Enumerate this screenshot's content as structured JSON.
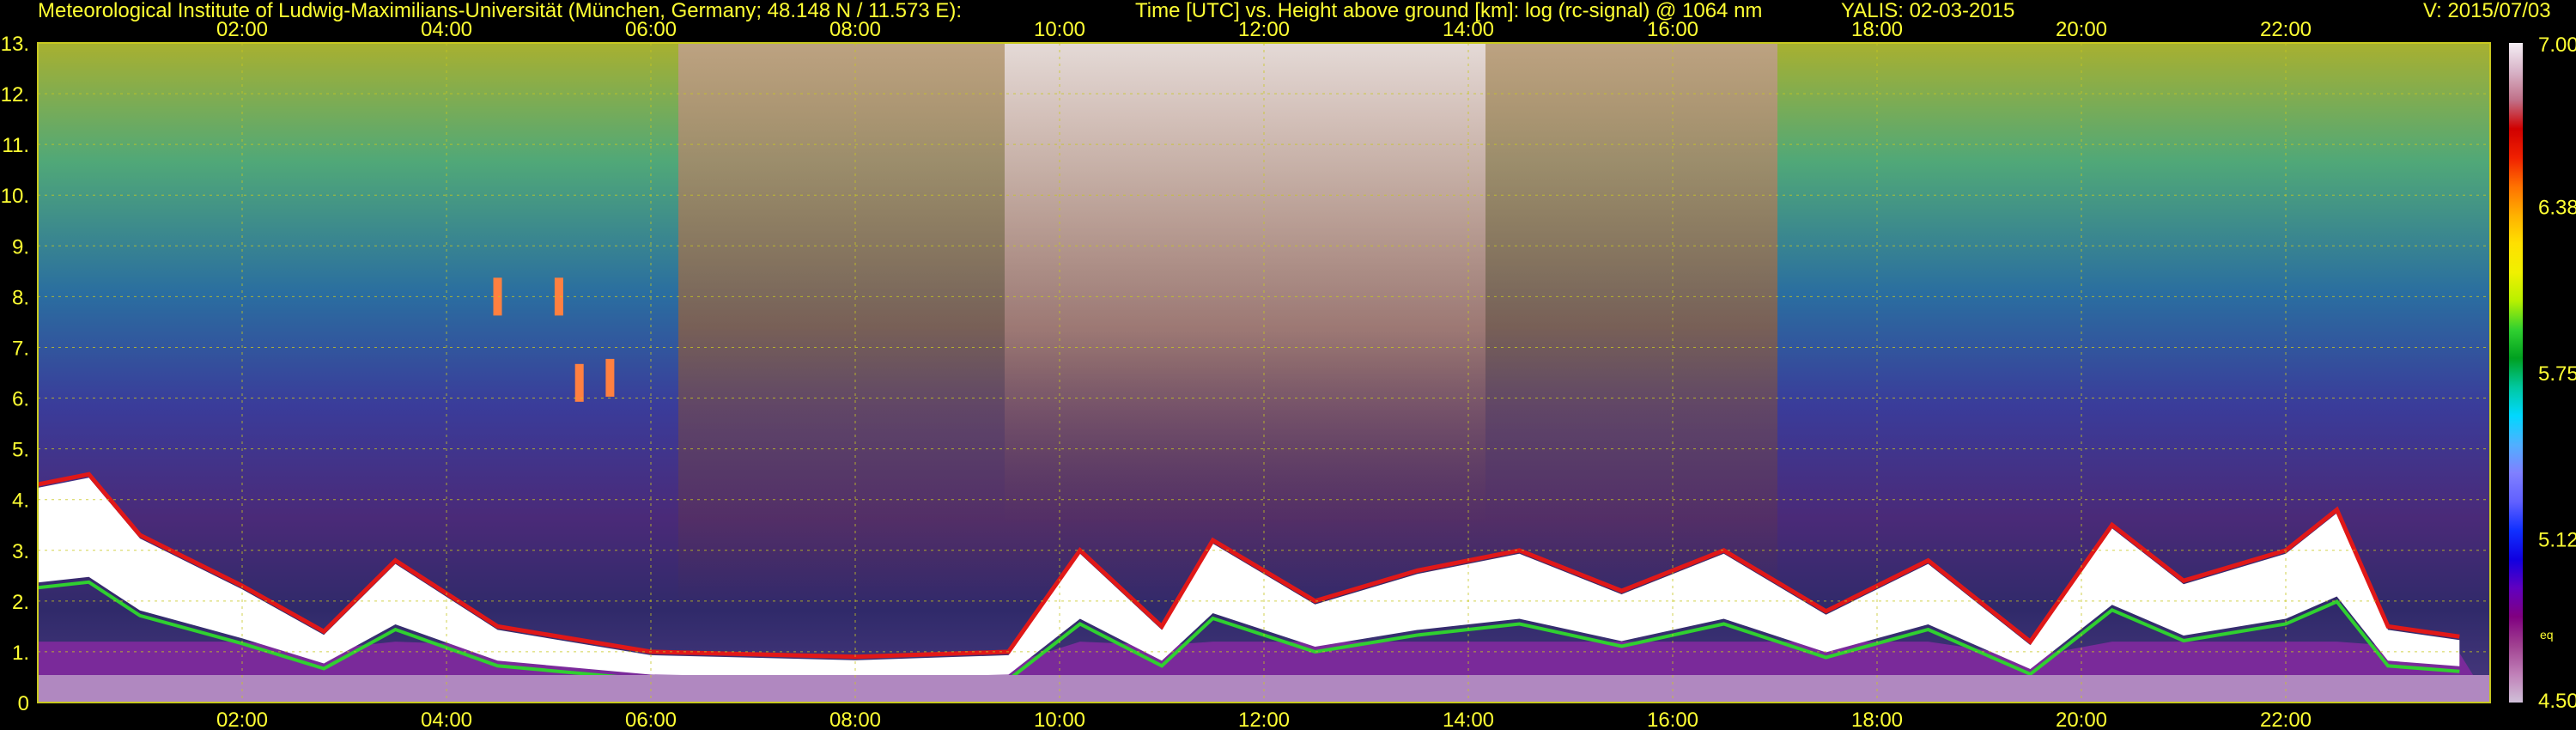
{
  "header": {
    "institute": "Meteorological Institute of Ludwig-Maximilians-Universität (München, Germany; 48.148 N / 11.573 E):",
    "title": "Time [UTC] vs. Height above ground [km]: log (rc-signal) @ 1064 nm",
    "instrument_date": "YALIS: 02-03-2015",
    "version": "V: 2015/07/03"
  },
  "colorbar": {
    "tick_labels": [
      "7.00",
      "6.38",
      "5.75",
      "5.12",
      "4.50"
    ],
    "tick_values": [
      7.0,
      6.38,
      5.75,
      5.12,
      4.5
    ],
    "extra_label": "eq",
    "colors": [
      "#f4eef4",
      "#d8b4c8",
      "#c07088",
      "#d00000",
      "#f02000",
      "#ff7000",
      "#ffb000",
      "#ffe000",
      "#f0f000",
      "#b8f000",
      "#30d030",
      "#00a020",
      "#00c8a0",
      "#00d8ff",
      "#50b0ff",
      "#8080ff",
      "#6060ff",
      "#1030ff",
      "#1000e0",
      "#6000c0",
      "#800080",
      "#a04090",
      "#c080b8",
      "#d0c0d8"
    ]
  },
  "chart_data": {
    "type": "heatmap",
    "title": "Time [UTC] vs. Height above ground [km]: log (rc-signal) @ 1064 nm",
    "x_ticks": [
      "02:00",
      "04:00",
      "06:00",
      "08:00",
      "10:00",
      "12:00",
      "14:00",
      "16:00",
      "18:00",
      "20:00",
      "22:00"
    ],
    "x_tick_hours": [
      2,
      4,
      6,
      8,
      10,
      12,
      14,
      16,
      18,
      20,
      22
    ],
    "xlim_hours": [
      0,
      24
    ],
    "y_ticks": [
      "0",
      "1.",
      "2.",
      "3.",
      "4.",
      "5.",
      "6.",
      "7.",
      "8.",
      "9.",
      "10.",
      "11.",
      "12.",
      "13."
    ],
    "y_tick_values": [
      0,
      1,
      2,
      3,
      4,
      5,
      6,
      7,
      8,
      9,
      10,
      11,
      12,
      13
    ],
    "ylim_km": [
      0,
      13
    ],
    "colorbar_range": [
      4.5,
      7.0
    ],
    "grid": true,
    "aerosol_layer_top_km": [
      [
        0.0,
        4.3
      ],
      [
        0.5,
        4.5
      ],
      [
        1.0,
        3.3
      ],
      [
        2.0,
        2.3
      ],
      [
        2.8,
        1.4
      ],
      [
        3.5,
        2.8
      ],
      [
        4.5,
        1.5
      ],
      [
        6.0,
        1.0
      ],
      [
        8.0,
        0.9
      ],
      [
        9.5,
        1.0
      ],
      [
        10.2,
        3.0
      ],
      [
        11.0,
        1.5
      ],
      [
        11.5,
        3.2
      ],
      [
        12.5,
        2.0
      ],
      [
        13.5,
        2.6
      ],
      [
        14.5,
        3.0
      ],
      [
        15.5,
        2.2
      ],
      [
        16.5,
        3.0
      ],
      [
        17.5,
        1.8
      ],
      [
        18.5,
        2.8
      ],
      [
        19.5,
        1.2
      ],
      [
        20.3,
        3.5
      ],
      [
        21.0,
        2.4
      ],
      [
        22.0,
        3.0
      ],
      [
        22.5,
        3.8
      ],
      [
        23.0,
        1.5
      ],
      [
        23.7,
        1.3
      ]
    ],
    "elevated_features_km": [
      {
        "time_h": 4.5,
        "height_km": 8.0
      },
      {
        "time_h": 5.1,
        "height_km": 8.0
      },
      {
        "time_h": 5.3,
        "height_km": 6.3
      },
      {
        "time_h": 5.6,
        "height_km": 6.4
      }
    ]
  }
}
